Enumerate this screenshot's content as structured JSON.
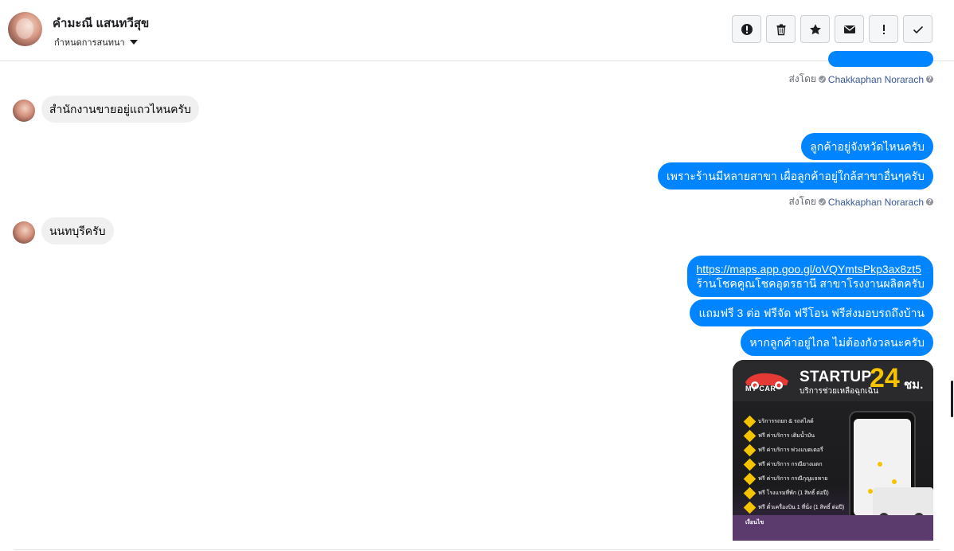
{
  "header": {
    "contact_name": "คำมะณี แสนทวีสุข",
    "subtitle": "กำหนดการสนทนา"
  },
  "toolbar": {
    "buttons": [
      {
        "icon": "alert-circle-icon"
      },
      {
        "icon": "trash-icon"
      },
      {
        "icon": "star-icon"
      },
      {
        "icon": "envelope-icon"
      },
      {
        "icon": "exclamation-icon"
      },
      {
        "icon": "check-icon"
      }
    ]
  },
  "messages": {
    "sent_by_label": "ส่งโดย",
    "sender_name": "Chakkaphan Norarach",
    "m1_in": "สำนักงานขายอยู่แถวไหนครับ",
    "m2_out": "ลูกค้าอยู่จังหวัดไหนครับ",
    "m3_out": "เพราะร้านมีหลายสาขา เผื่อลูกค้าอยู่ใกล้สาขาอื่นๆครับ",
    "m4_in": "นนทบุรีครับ",
    "m5_link": "https://maps.app.goo.gl/oVQYmtsPkp3ax8zt5",
    "m5_text": "ร้านโชคคูณโชคอุดรธานี สาขาโรงงานผลิตครับ",
    "m6_out": "แถมฟรี 3 ต่อ ฟรีจัด ฟรีโอน  ฟรีส่งมอบรถถึงบ้าน",
    "m7_out": "หากลูกค้าอยู่ไกล ไม่ต้องกังวลนะครับ"
  },
  "image_card": {
    "logo_text": "MY CAR",
    "headline": "STARTUP",
    "tagline": "บริการช่วยเหลือฉุกเฉิน",
    "hours": "24",
    "hours_unit": "ชม.",
    "services": [
      "บริการรถยก & รถสไลด์",
      "ฟรี ค่าบริการ เติมน้ำมัน",
      "ฟรี ค่าบริการ พ่วงแบตเตอรี่",
      "ฟรี ค่าบริการ กรณียางแตก",
      "ฟรี ค่าบริการ กรณีกุญแจหาย",
      "ฟรี โรงแรมที่พัก (1 สิทธิ์ ต่อปี)",
      "ฟรี ตั๋วเครื่องบิน 1 ที่นั่ง (1 สิทธิ์ ต่อปี)"
    ],
    "footer_label": "เงื่อนไข"
  },
  "colors": {
    "outgoing_bubble": "#0084ff",
    "incoming_bubble": "#f1f0f0",
    "sender_link": "#385898",
    "card_accent": "#f5c400"
  }
}
